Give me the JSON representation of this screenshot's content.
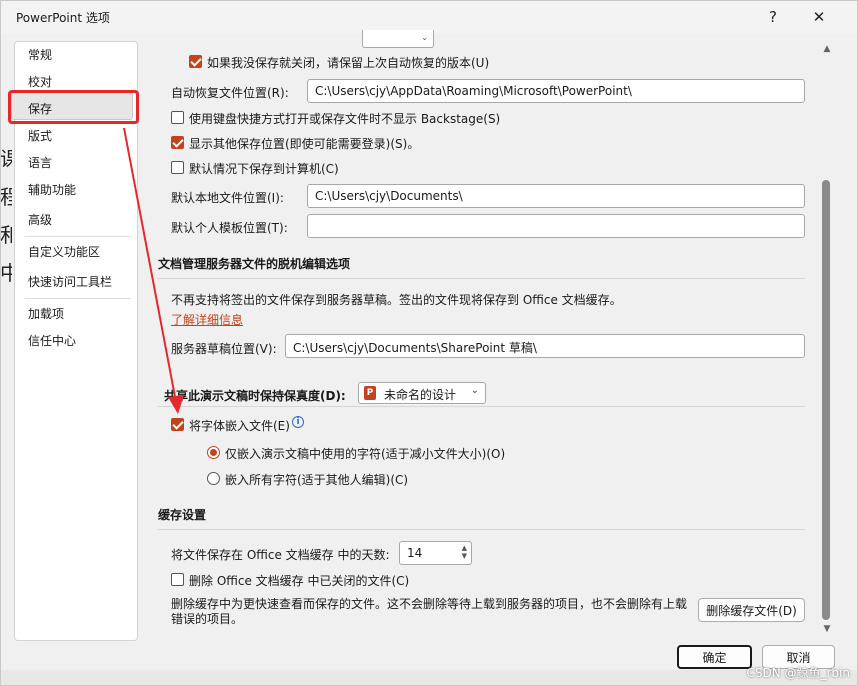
{
  "window": {
    "title": "PowerPoint 选项",
    "help": "?",
    "close": "✕"
  },
  "background_text": "课\n程\n和\n中",
  "nav": {
    "items": [
      {
        "label": "常规"
      },
      {
        "label": "校对"
      },
      {
        "label": "保存"
      },
      {
        "label": "版式"
      },
      {
        "label": "语言"
      },
      {
        "label": "辅助功能"
      },
      {
        "label": "高级"
      },
      {
        "label": "自定义功能区"
      },
      {
        "label": "快速访问工具栏"
      },
      {
        "label": "加载项"
      },
      {
        "label": "信任中心"
      }
    ],
    "selected": "保存"
  },
  "save": {
    "keep_last_version": "如果我没保存就关闭，请保留上次自动恢复的版本(U)",
    "autorecover_label": "自动恢复文件位置(R):",
    "autorecover_value": "C:\\Users\\cjy\\AppData\\Roaming\\Microsoft\\PowerPoint\\",
    "no_backstage": "使用键盘快捷方式打开或保存文件时不显示 Backstage(S)",
    "show_other_locations": "显示其他保存位置(即使可能需要登录)(S)。",
    "save_to_computer": "默认情况下保存到计算机(C)",
    "local_location_label": "默认本地文件位置(I):",
    "local_location_value": "C:\\Users\\cjy\\Documents\\",
    "template_location_label": "默认个人模板位置(T):",
    "template_location_value": ""
  },
  "offline": {
    "title": "文档管理服务器文件的脱机编辑选项",
    "note": "不再支持将签出的文件保存到服务器草稿。签出的文件现将保存到 Office 文档缓存。",
    "learn_more": "了解详细信息",
    "drafts_label": "服务器草稿位置(V):",
    "drafts_value": "C:\\Users\\cjy\\Documents\\SharePoint 草稿\\"
  },
  "fidelity": {
    "label": "共享此演示文稿时保持保真度(D):",
    "presentation": "未命名的设计",
    "embed_fonts": "将字体嵌入文件(E)",
    "only_used": "仅嵌入演示文稿中使用的字符(适于减小文件大小)(O)",
    "all_chars": "嵌入所有字符(适于其他人编辑)(C)"
  },
  "cache": {
    "title": "缓存设置",
    "days_label": "将文件保存在 Office 文档缓存 中的天数:",
    "days_value": "14",
    "delete_closed": "删除 Office 文档缓存 中已关闭的文件(C)",
    "delete_note": "删除缓存中为更快速查看而保存的文件。这不会删除等待上载到服务器的项目，也不会删除有上载错误的项目。",
    "delete_button": "删除缓存文件(D)"
  },
  "footer": {
    "ok": "确定",
    "cancel": "取消"
  },
  "watermark": "CSDN @鲸鱼_rbin",
  "colors": {
    "accent": "#c4421c",
    "annotation_red": "#e5282c"
  }
}
